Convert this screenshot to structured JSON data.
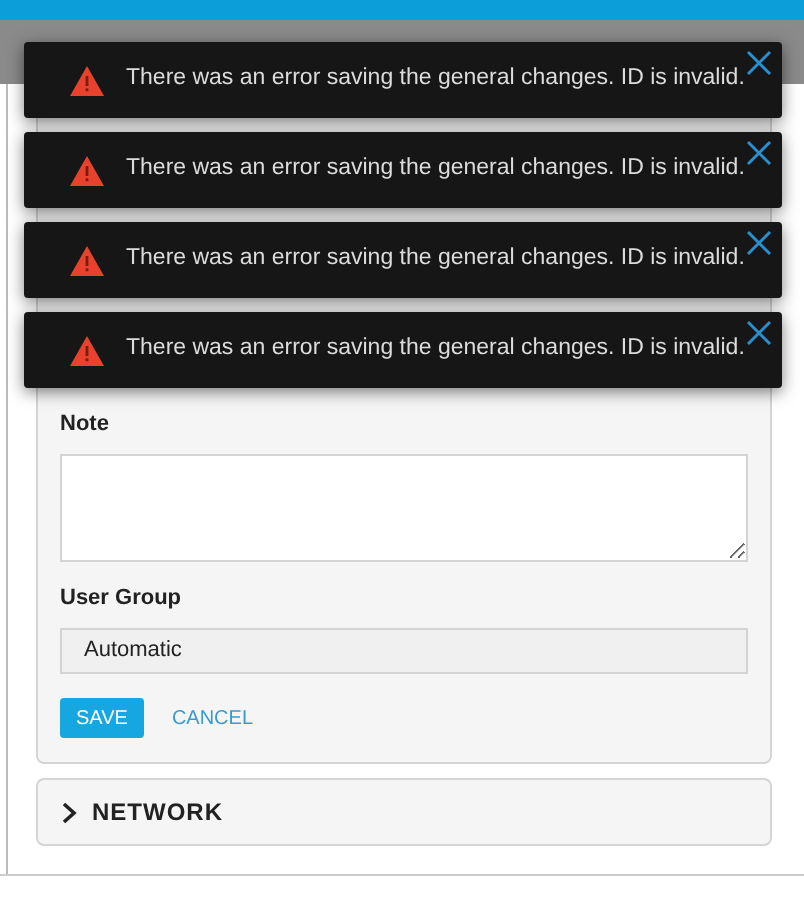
{
  "toasts": [
    {
      "message": "There was an error saving the general changes. ID is invalid.",
      "kind": "error"
    },
    {
      "message": "There was an error saving the general changes. ID is invalid.",
      "kind": "error"
    },
    {
      "message": "There was an error saving the general changes. ID is invalid.",
      "kind": "error"
    },
    {
      "message": "There was an error saving the general changes. ID is invalid.",
      "kind": "error"
    }
  ],
  "form": {
    "note_label": "Note",
    "user_group_label": "User Group",
    "user_group_value": "Automatic",
    "save": "SAVE",
    "cancel": "CANCEL"
  },
  "sections": [
    {
      "title": "NETWORK",
      "expanded": false
    }
  ]
}
